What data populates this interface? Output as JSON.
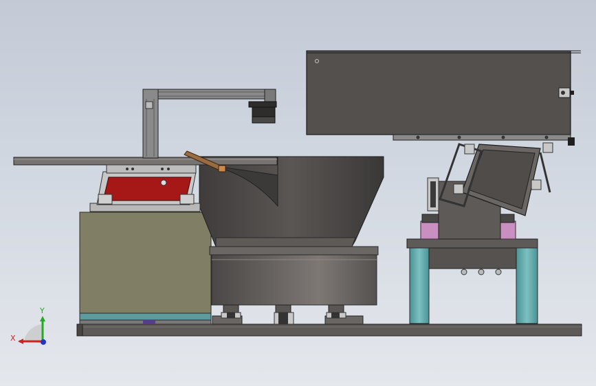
{
  "viewport": {
    "background_top": "#c3cad6",
    "background_bottom": "#e4e7ec"
  },
  "colors": {
    "dark_steel": "#54504d",
    "bowl_shell": "#4f4c4a",
    "base_plate": "#5e5a57",
    "olive_cabinet": "#807e64",
    "teal_posts": "#5fa6a8",
    "pink_dampers": "#c98fc1",
    "red_panel": "#a61818",
    "copper_lever": "#9a6a40",
    "frame_grey": "#8a8a8a"
  },
  "components": [
    {
      "name": "overhead-hopper-box"
    },
    {
      "name": "aluminum-profile-frame"
    },
    {
      "name": "hanging-camera-sensor"
    },
    {
      "name": "vibratory-bowl"
    },
    {
      "name": "bowl-base-drum"
    },
    {
      "name": "linear-feed-track"
    },
    {
      "name": "left-cabinet"
    },
    {
      "name": "red-tilted-panel"
    },
    {
      "name": "right-tilting-hopper"
    },
    {
      "name": "right-support-posts"
    },
    {
      "name": "bottom-base-plate"
    }
  ],
  "triad": {
    "x_label": "X",
    "y_label": "Y",
    "x_color": "#cc2222",
    "y_color": "#22aa22",
    "z_color": "#2233cc"
  }
}
